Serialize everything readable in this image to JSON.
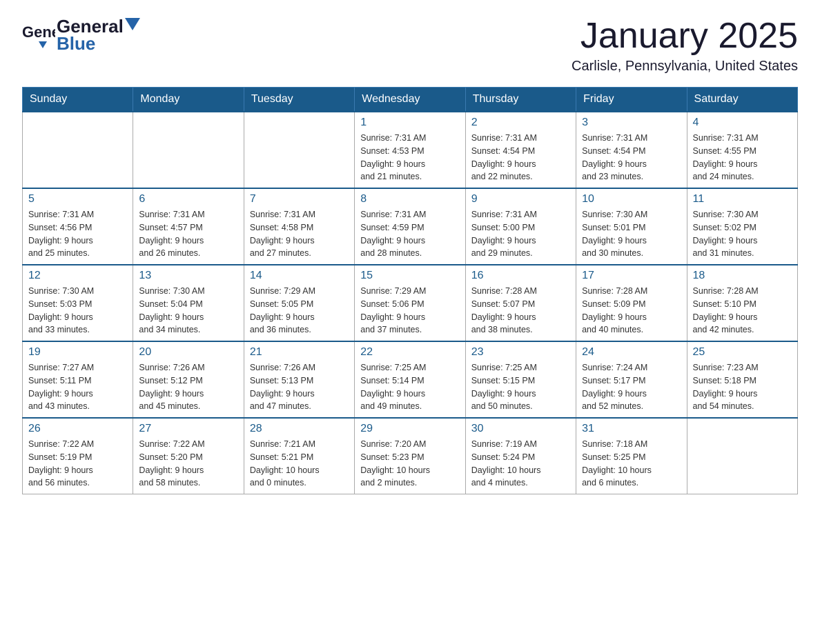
{
  "header": {
    "logo_general": "General",
    "logo_blue": "Blue",
    "month_title": "January 2025",
    "location": "Carlisle, Pennsylvania, United States"
  },
  "days_of_week": [
    "Sunday",
    "Monday",
    "Tuesday",
    "Wednesday",
    "Thursday",
    "Friday",
    "Saturday"
  ],
  "weeks": [
    [
      {
        "day": "",
        "info": ""
      },
      {
        "day": "",
        "info": ""
      },
      {
        "day": "",
        "info": ""
      },
      {
        "day": "1",
        "info": "Sunrise: 7:31 AM\nSunset: 4:53 PM\nDaylight: 9 hours\nand 21 minutes."
      },
      {
        "day": "2",
        "info": "Sunrise: 7:31 AM\nSunset: 4:54 PM\nDaylight: 9 hours\nand 22 minutes."
      },
      {
        "day": "3",
        "info": "Sunrise: 7:31 AM\nSunset: 4:54 PM\nDaylight: 9 hours\nand 23 minutes."
      },
      {
        "day": "4",
        "info": "Sunrise: 7:31 AM\nSunset: 4:55 PM\nDaylight: 9 hours\nand 24 minutes."
      }
    ],
    [
      {
        "day": "5",
        "info": "Sunrise: 7:31 AM\nSunset: 4:56 PM\nDaylight: 9 hours\nand 25 minutes."
      },
      {
        "day": "6",
        "info": "Sunrise: 7:31 AM\nSunset: 4:57 PM\nDaylight: 9 hours\nand 26 minutes."
      },
      {
        "day": "7",
        "info": "Sunrise: 7:31 AM\nSunset: 4:58 PM\nDaylight: 9 hours\nand 27 minutes."
      },
      {
        "day": "8",
        "info": "Sunrise: 7:31 AM\nSunset: 4:59 PM\nDaylight: 9 hours\nand 28 minutes."
      },
      {
        "day": "9",
        "info": "Sunrise: 7:31 AM\nSunset: 5:00 PM\nDaylight: 9 hours\nand 29 minutes."
      },
      {
        "day": "10",
        "info": "Sunrise: 7:30 AM\nSunset: 5:01 PM\nDaylight: 9 hours\nand 30 minutes."
      },
      {
        "day": "11",
        "info": "Sunrise: 7:30 AM\nSunset: 5:02 PM\nDaylight: 9 hours\nand 31 minutes."
      }
    ],
    [
      {
        "day": "12",
        "info": "Sunrise: 7:30 AM\nSunset: 5:03 PM\nDaylight: 9 hours\nand 33 minutes."
      },
      {
        "day": "13",
        "info": "Sunrise: 7:30 AM\nSunset: 5:04 PM\nDaylight: 9 hours\nand 34 minutes."
      },
      {
        "day": "14",
        "info": "Sunrise: 7:29 AM\nSunset: 5:05 PM\nDaylight: 9 hours\nand 36 minutes."
      },
      {
        "day": "15",
        "info": "Sunrise: 7:29 AM\nSunset: 5:06 PM\nDaylight: 9 hours\nand 37 minutes."
      },
      {
        "day": "16",
        "info": "Sunrise: 7:28 AM\nSunset: 5:07 PM\nDaylight: 9 hours\nand 38 minutes."
      },
      {
        "day": "17",
        "info": "Sunrise: 7:28 AM\nSunset: 5:09 PM\nDaylight: 9 hours\nand 40 minutes."
      },
      {
        "day": "18",
        "info": "Sunrise: 7:28 AM\nSunset: 5:10 PM\nDaylight: 9 hours\nand 42 minutes."
      }
    ],
    [
      {
        "day": "19",
        "info": "Sunrise: 7:27 AM\nSunset: 5:11 PM\nDaylight: 9 hours\nand 43 minutes."
      },
      {
        "day": "20",
        "info": "Sunrise: 7:26 AM\nSunset: 5:12 PM\nDaylight: 9 hours\nand 45 minutes."
      },
      {
        "day": "21",
        "info": "Sunrise: 7:26 AM\nSunset: 5:13 PM\nDaylight: 9 hours\nand 47 minutes."
      },
      {
        "day": "22",
        "info": "Sunrise: 7:25 AM\nSunset: 5:14 PM\nDaylight: 9 hours\nand 49 minutes."
      },
      {
        "day": "23",
        "info": "Sunrise: 7:25 AM\nSunset: 5:15 PM\nDaylight: 9 hours\nand 50 minutes."
      },
      {
        "day": "24",
        "info": "Sunrise: 7:24 AM\nSunset: 5:17 PM\nDaylight: 9 hours\nand 52 minutes."
      },
      {
        "day": "25",
        "info": "Sunrise: 7:23 AM\nSunset: 5:18 PM\nDaylight: 9 hours\nand 54 minutes."
      }
    ],
    [
      {
        "day": "26",
        "info": "Sunrise: 7:22 AM\nSunset: 5:19 PM\nDaylight: 9 hours\nand 56 minutes."
      },
      {
        "day": "27",
        "info": "Sunrise: 7:22 AM\nSunset: 5:20 PM\nDaylight: 9 hours\nand 58 minutes."
      },
      {
        "day": "28",
        "info": "Sunrise: 7:21 AM\nSunset: 5:21 PM\nDaylight: 10 hours\nand 0 minutes."
      },
      {
        "day": "29",
        "info": "Sunrise: 7:20 AM\nSunset: 5:23 PM\nDaylight: 10 hours\nand 2 minutes."
      },
      {
        "day": "30",
        "info": "Sunrise: 7:19 AM\nSunset: 5:24 PM\nDaylight: 10 hours\nand 4 minutes."
      },
      {
        "day": "31",
        "info": "Sunrise: 7:18 AM\nSunset: 5:25 PM\nDaylight: 10 hours\nand 6 minutes."
      },
      {
        "day": "",
        "info": ""
      }
    ]
  ]
}
